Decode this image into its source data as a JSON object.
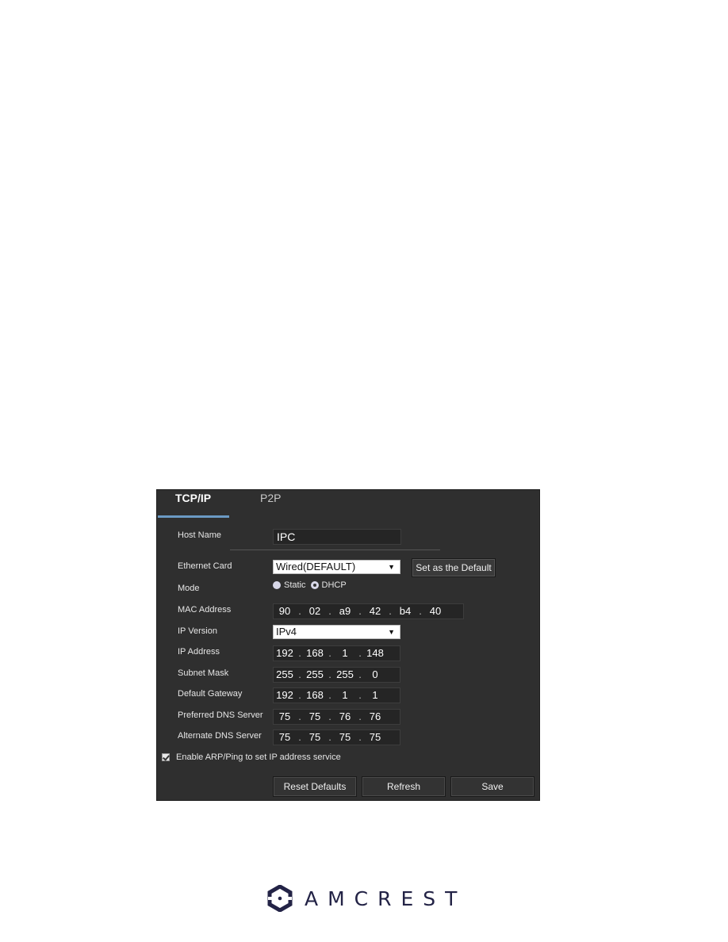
{
  "tabs": [
    {
      "label": "TCP/IP",
      "active": true
    },
    {
      "label": "P2P",
      "active": false
    }
  ],
  "form": {
    "host_name": {
      "label": "Host Name",
      "value": "IPC"
    },
    "ethernet_card": {
      "label": "Ethernet Card",
      "value": "Wired(DEFAULT)",
      "set_default_label": "Set as the Default"
    },
    "mode": {
      "label": "Mode",
      "options": [
        "Static",
        "DHCP"
      ],
      "selected": "DHCP"
    },
    "mac_address": {
      "label": "MAC Address",
      "octets": [
        "90",
        "02",
        "a9",
        "42",
        "b4",
        "40"
      ]
    },
    "ip_version": {
      "label": "IP Version",
      "value": "IPv4"
    },
    "ip_address": {
      "label": "IP Address",
      "octets": [
        "192",
        "168",
        "1",
        "148"
      ]
    },
    "subnet_mask": {
      "label": "Subnet Mask",
      "octets": [
        "255",
        "255",
        "255",
        "0"
      ]
    },
    "default_gateway": {
      "label": "Default Gateway",
      "octets": [
        "192",
        "168",
        "1",
        "1"
      ]
    },
    "preferred_dns": {
      "label": "Preferred DNS Server",
      "octets": [
        "75",
        "75",
        "76",
        "76"
      ]
    },
    "alternate_dns": {
      "label": "Alternate DNS Server",
      "octets": [
        "75",
        "75",
        "75",
        "75"
      ]
    },
    "arp_ping": {
      "label": "Enable ARP/Ping to set IP address service",
      "checked": true
    }
  },
  "buttons": {
    "reset": "Reset Defaults",
    "refresh": "Refresh",
    "save": "Save"
  },
  "icons": {
    "dropdown_arrow": "▼"
  },
  "brand": {
    "name": "AMCREST",
    "color": "#232346"
  },
  "colors": {
    "panel_bg": "#2f2f2f",
    "tab_accent": "#6b9ac4"
  }
}
